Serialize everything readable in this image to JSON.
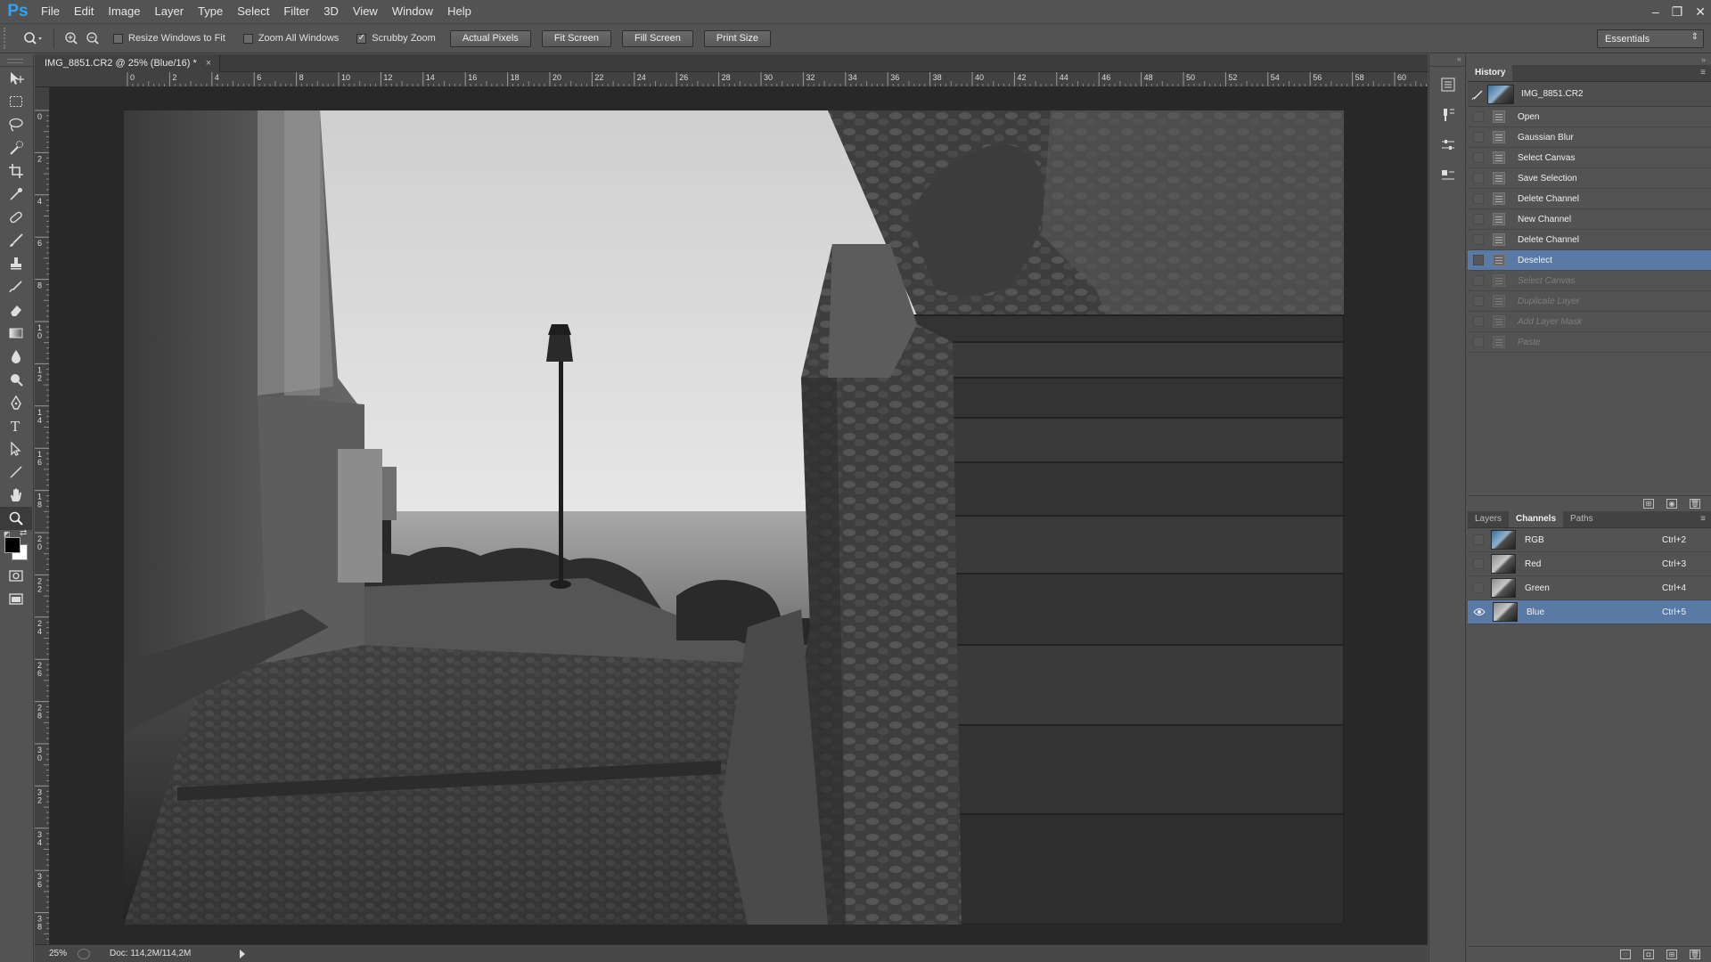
{
  "app": {
    "logo": "Ps"
  },
  "menu": [
    "File",
    "Edit",
    "Image",
    "Layer",
    "Type",
    "Select",
    "Filter",
    "3D",
    "View",
    "Window",
    "Help"
  ],
  "window_controls": {
    "minimize": "–",
    "restore": "❐",
    "close": "✕"
  },
  "options": {
    "resize_windows": {
      "label": "Resize Windows to Fit",
      "checked": false
    },
    "zoom_all": {
      "label": "Zoom All Windows",
      "checked": false
    },
    "scrubby_zoom": {
      "label": "Scrubby Zoom",
      "checked": true
    },
    "buttons": [
      "Actual Pixels",
      "Fit Screen",
      "Fill Screen",
      "Print Size"
    ],
    "workspace": "Essentials"
  },
  "document": {
    "tab_title": "IMG_8851.CR2 @ 25% (Blue/16) *",
    "close": "×",
    "ruler_h": [
      "0",
      "2",
      "4",
      "6",
      "8",
      "10",
      "12",
      "14",
      "16",
      "18",
      "20",
      "22",
      "24",
      "26",
      "28",
      "30",
      "32",
      "34",
      "36",
      "38",
      "40",
      "42",
      "44",
      "46",
      "48",
      "50",
      "52",
      "54",
      "56",
      "58",
      "60"
    ],
    "ruler_v": [
      "0",
      "2",
      "4",
      "6",
      "8",
      "10",
      "12",
      "14",
      "16",
      "18",
      "20",
      "22",
      "24",
      "26",
      "28",
      "30",
      "32",
      "34",
      "36",
      "38"
    ],
    "zoom": "25%",
    "doc_size": "Doc: 114,2M/114,2M"
  },
  "history": {
    "tab": "History",
    "snapshot": "IMG_8851.CR2",
    "items": [
      {
        "label": "Open",
        "state": "normal"
      },
      {
        "label": "Gaussian Blur",
        "state": "normal"
      },
      {
        "label": "Select Canvas",
        "state": "normal"
      },
      {
        "label": "Save Selection",
        "state": "normal"
      },
      {
        "label": "Delete Channel",
        "state": "normal"
      },
      {
        "label": "New Channel",
        "state": "normal"
      },
      {
        "label": "Delete Channel",
        "state": "normal"
      },
      {
        "label": "Deselect",
        "state": "selected"
      },
      {
        "label": "Select Canvas",
        "state": "undone"
      },
      {
        "label": "Duplicate Layer",
        "state": "undone"
      },
      {
        "label": "Add Layer Mask",
        "state": "undone"
      },
      {
        "label": "Paste",
        "state": "undone"
      }
    ]
  },
  "channels_panel": {
    "tabs": [
      "Layers",
      "Channels",
      "Paths"
    ],
    "active_tab": "Channels",
    "rows": [
      {
        "name": "RGB",
        "shortcut": "Ctrl+2",
        "visible": false
      },
      {
        "name": "Red",
        "shortcut": "Ctrl+3",
        "visible": false
      },
      {
        "name": "Green",
        "shortcut": "Ctrl+4",
        "visible": false
      },
      {
        "name": "Blue",
        "shortcut": "Ctrl+5",
        "visible": true,
        "selected": true
      }
    ]
  },
  "colors": {
    "selection": "#5a7aa6",
    "chrome": "#535353",
    "canvas": "#282828",
    "accent": "#2fa3f5"
  }
}
